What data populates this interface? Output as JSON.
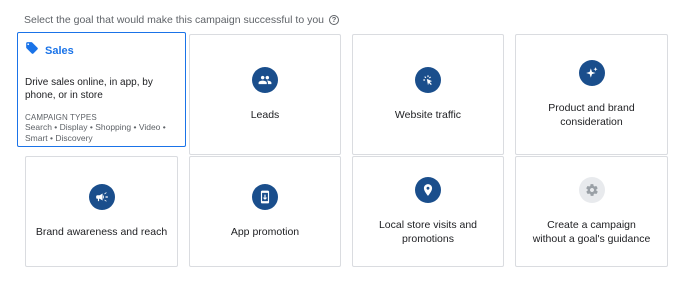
{
  "prompt": {
    "text": "Select the goal that would make this campaign successful to you",
    "help_glyph": "?"
  },
  "selected": {
    "title": "Sales",
    "description": "Drive sales online, in app, by phone, or in store",
    "types_heading": "CAMPAIGN TYPES",
    "types": "Search • Display • Shopping • Video • Smart • Discovery",
    "icon": "tag-icon"
  },
  "goals": {
    "leads": {
      "label": "Leads",
      "icon": "people-icon"
    },
    "website_traffic": {
      "label": "Website traffic",
      "icon": "cursor-click-icon"
    },
    "consideration": {
      "label": "Product and brand consideration",
      "icon": "sparkle-icon"
    },
    "awareness": {
      "label": "Brand awareness and reach",
      "icon": "megaphone-icon"
    },
    "app": {
      "label": "App promotion",
      "icon": "phone-download-icon"
    },
    "local": {
      "label": "Local store visits and promotions",
      "icon": "map-pin-icon"
    },
    "no_goal": {
      "label": "Create a campaign without a goal's guidance",
      "icon": "gear-icon"
    }
  },
  "colors": {
    "accent": "#1a73e8",
    "icon_bg": "#1a4e8c",
    "icon_bg_disabled": "#e8eaed",
    "border": "#dadce0"
  }
}
